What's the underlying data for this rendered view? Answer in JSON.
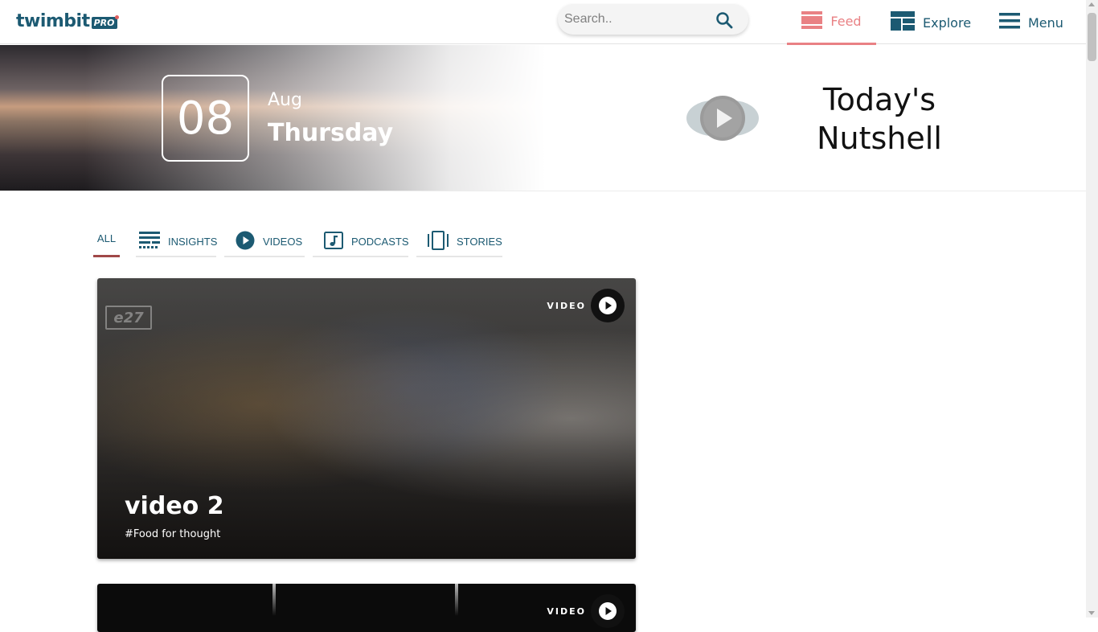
{
  "header": {
    "logo_text": "twimbit",
    "logo_badge": "PRO",
    "search_placeholder": "Search..",
    "nav": {
      "feed": "Feed",
      "explore": "Explore",
      "menu": "Menu"
    },
    "active_nav": "feed",
    "accent_color": "#e98184",
    "brand_color": "#1c5a72"
  },
  "banner": {
    "day_number": "08",
    "month": "Aug",
    "weekday": "Thursday",
    "nutshell_line1": "Today's",
    "nutshell_line2": "Nutshell"
  },
  "filters": {
    "active": "all",
    "items": {
      "all": "ALL",
      "insights": "INSIGHTS",
      "videos": "VIDEOS",
      "podcasts": "PODCASTS",
      "stories": "STORIES"
    }
  },
  "cards": [
    {
      "type_label": "VIDEO",
      "watermark": "e27",
      "title": "video 2",
      "tag": "#Food for thought"
    },
    {
      "type_label": "VIDEO"
    }
  ]
}
